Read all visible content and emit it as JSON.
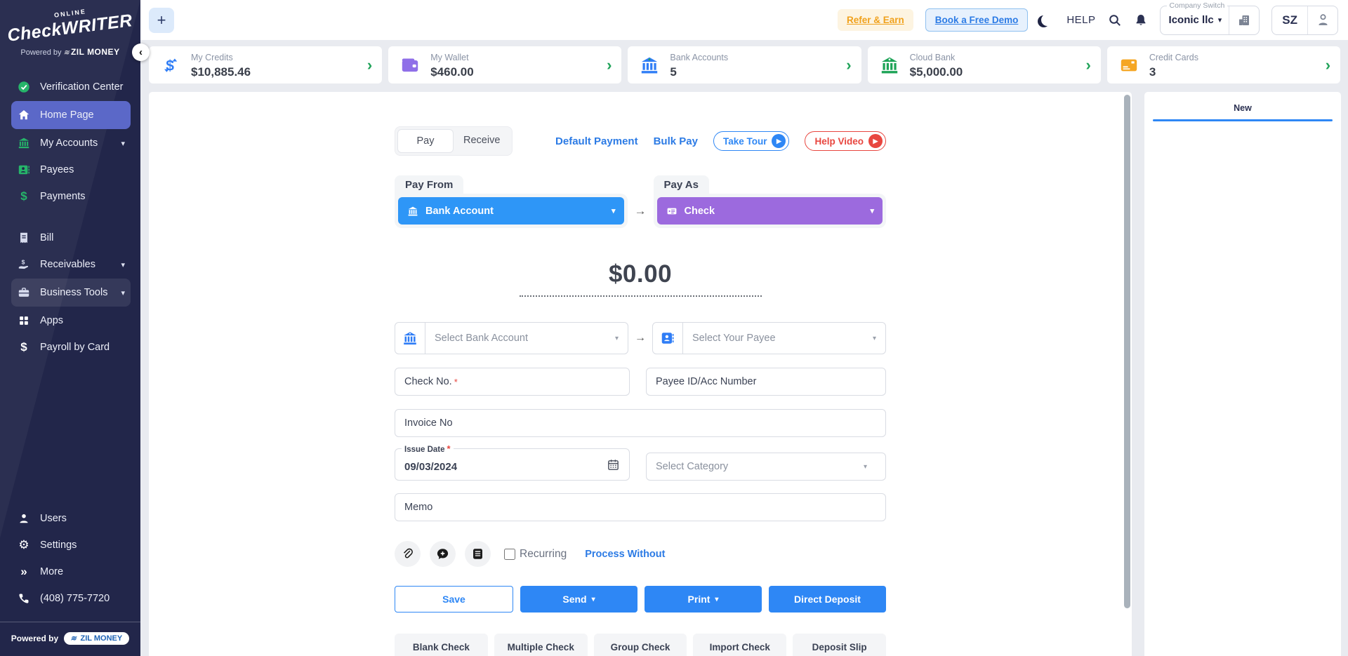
{
  "colors": {
    "accent_blue": "#2e87f5",
    "dropdown_blue": "#2e96f7",
    "dropdown_purple": "#9c6ade",
    "green": "#21a35a",
    "sidebar_green": "#26b56a",
    "orange": "#f0a11c",
    "red": "#e8463f",
    "sidebar_active": "#5b68c8",
    "sidebar_bg": "#22264a"
  },
  "icons": {
    "plus": "+",
    "chevron_down": "▾",
    "chevron_right": "›",
    "chevron_left": "‹",
    "arrow_right": "→",
    "double_chevron": "»",
    "dollar": "$",
    "gear": "⚙",
    "play": "▶"
  },
  "sidebar": {
    "logo": {
      "online": "ONLINE",
      "brand": "CheckWRITER",
      "powered": "Powered by",
      "powered_brand": "ZIL MONEY"
    },
    "items": [
      {
        "label": "Verification Center"
      },
      {
        "label": "Home Page"
      },
      {
        "label": "My Accounts"
      },
      {
        "label": "Payees"
      },
      {
        "label": "Payments"
      },
      {
        "label": "Bill"
      },
      {
        "label": "Receivables"
      },
      {
        "label": "Business Tools"
      },
      {
        "label": "Apps"
      },
      {
        "label": "Payroll by Card"
      }
    ],
    "footer_items": [
      {
        "label": "Users"
      },
      {
        "label": "Settings"
      },
      {
        "label": "More"
      },
      {
        "label": "(408) 775-7720"
      }
    ],
    "powered_by": "Powered by",
    "powered_badge": "ZIL MONEY"
  },
  "header": {
    "refer_earn": "Refer & Earn",
    "book_demo": "Book a Free Demo",
    "help": "HELP",
    "company_switch": {
      "label": "Company Switch",
      "value": "Iconic llc"
    },
    "avatar_initials": "SZ"
  },
  "stats_cards": [
    {
      "label": "My Credits",
      "value": "$10,885.46"
    },
    {
      "label": "My Wallet",
      "value": "$460.00"
    },
    {
      "label": "Bank Accounts",
      "value": "5"
    },
    {
      "label": "Cloud Bank",
      "value": "$5,000.00"
    },
    {
      "label": "Credit Cards",
      "value": "3"
    }
  ],
  "form": {
    "tabs": {
      "pay": "Pay",
      "receive": "Receive"
    },
    "links": {
      "default_payment": "Default Payment",
      "bulk_pay": "Bulk Pay",
      "take_tour": "Take Tour",
      "help_video": "Help Video"
    },
    "pay_from": {
      "label": "Pay From",
      "value": "Bank Account"
    },
    "pay_as": {
      "label": "Pay As",
      "value": "Check"
    },
    "amount": "$0.00",
    "selects": {
      "bank": "Select Bank Account",
      "payee": "Select Your Payee"
    },
    "fields": {
      "check_no": "Check No.",
      "required_marker": "*",
      "payee_id": "Payee ID/Acc Number",
      "invoice_no": "Invoice No",
      "issue_date_label": "Issue Date",
      "issue_date_value": "09/03/2024",
      "category": "Select Category",
      "memo": "Memo"
    },
    "options": {
      "recurring": "Recurring",
      "process_without": "Process Without"
    },
    "actions": {
      "save": "Save",
      "send": "Send",
      "print": "Print",
      "direct_deposit": "Direct Deposit"
    },
    "quick_actions": [
      "Blank Check",
      "Multiple Check",
      "Group Check",
      "Import Check",
      "Deposit Slip"
    ]
  },
  "right_panel": {
    "tab": "New"
  }
}
